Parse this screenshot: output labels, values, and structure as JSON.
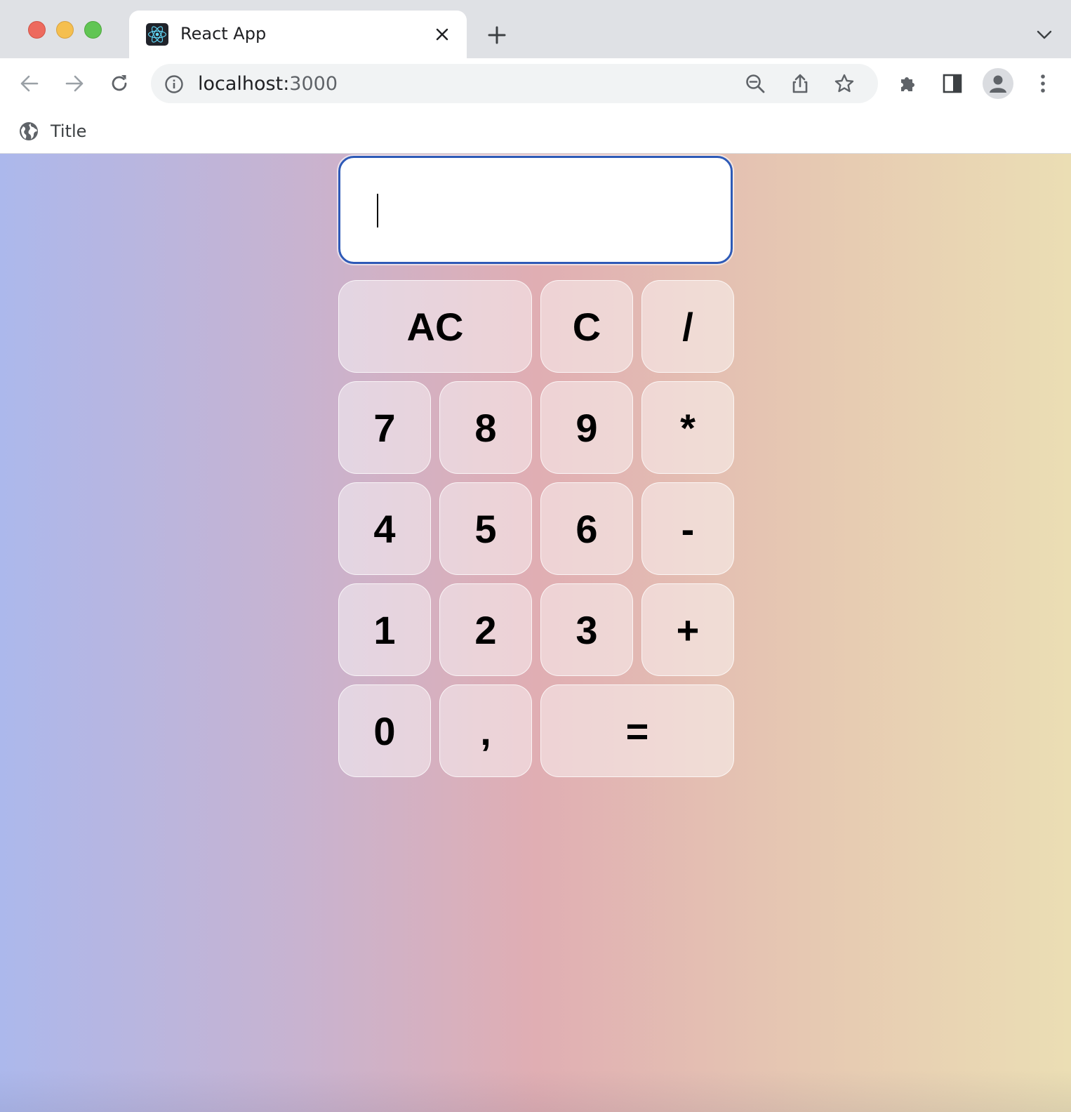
{
  "browser": {
    "tab": {
      "title": "React App",
      "favicon": "react-logo-icon"
    },
    "toolbar": {
      "url_host": "localhost:",
      "url_port": "3000"
    },
    "bookmarks": [
      {
        "label": "Title",
        "icon": "globe-icon"
      }
    ]
  },
  "calculator": {
    "display": {
      "value": "",
      "placeholder": ""
    },
    "keys": [
      {
        "label": "AC",
        "name": "key-all-clear"
      },
      {
        "label": "C",
        "name": "key-clear"
      },
      {
        "label": "/",
        "name": "key-divide"
      },
      {
        "label": "7",
        "name": "key-7"
      },
      {
        "label": "8",
        "name": "key-8"
      },
      {
        "label": "9",
        "name": "key-9"
      },
      {
        "label": "*",
        "name": "key-multiply"
      },
      {
        "label": "4",
        "name": "key-4"
      },
      {
        "label": "5",
        "name": "key-5"
      },
      {
        "label": "6",
        "name": "key-6"
      },
      {
        "label": "-",
        "name": "key-subtract"
      },
      {
        "label": "1",
        "name": "key-1"
      },
      {
        "label": "2",
        "name": "key-2"
      },
      {
        "label": "3",
        "name": "key-3"
      },
      {
        "label": "+",
        "name": "key-add"
      },
      {
        "label": "0",
        "name": "key-0"
      },
      {
        "label": ",",
        "name": "key-decimal"
      },
      {
        "label": "=",
        "name": "key-equals"
      }
    ]
  },
  "colors": {
    "display_border": "#2e5ab7",
    "gradient_left": "#acb8ec",
    "gradient_mid": "#e0aeb3",
    "gradient_right": "#ebdeb4"
  }
}
